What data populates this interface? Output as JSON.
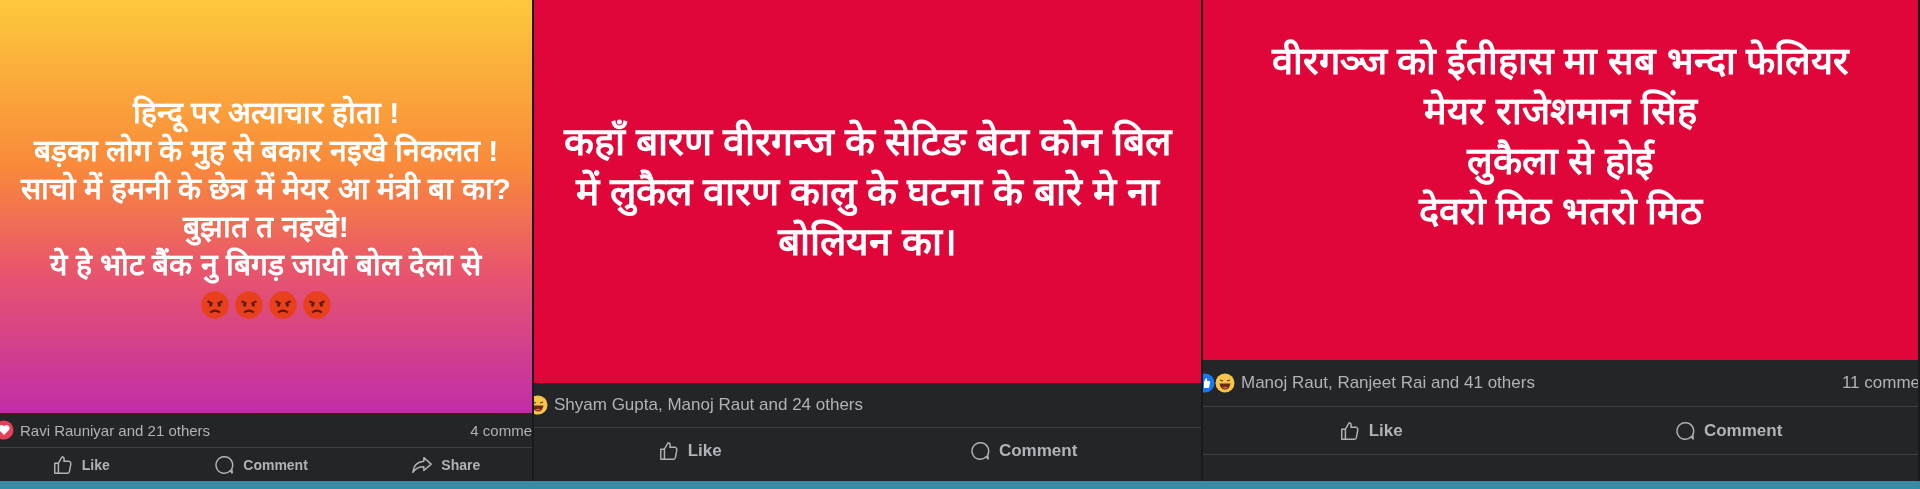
{
  "posts": [
    {
      "kind": "gradient",
      "lines": [
        "हिन्दू पर अत्याचार होता !",
        "बड़का लोग के मुह से बकार नइखे निकलत !",
        "साचो में हमनी के छेत्र में मेयर आ मंत्री बा का? बुझात त नइखे!",
        "ये हे भोट बैंक नु बिगड़ जायी बोल देला से"
      ],
      "emojis": [
        {
          "kind": "angry"
        },
        {
          "kind": "angry"
        },
        {
          "kind": "angry"
        },
        {
          "kind": "angry"
        }
      ],
      "reactions": [
        {
          "kind": "love"
        }
      ],
      "reacted_by": "Ravi Rauniyar and 21 others",
      "comments": "4 comme",
      "actions": [
        {
          "kind": "like",
          "label": "Like"
        },
        {
          "kind": "comment",
          "label": "Comment"
        },
        {
          "kind": "share",
          "label": "Share"
        }
      ]
    },
    {
      "kind": "red",
      "lines": [
        "कहाँ बारण वीरगन्ज के सेटिङ बेटा कोन बिल में लुकैल वारण कालु के घटना के बारे मे ना बोलियन का।"
      ],
      "reactions": [
        {
          "kind": "haha"
        }
      ],
      "reacted_by": "Shyam Gupta, Manoj Raut and 24 others",
      "actions": [
        {
          "kind": "like",
          "label": "Like"
        },
        {
          "kind": "comment",
          "label": "Comment"
        }
      ]
    },
    {
      "kind": "red",
      "lines": [
        "वीरगञ्ज को ईतीहास मा सब भन्दा फेलियर",
        "मेयर राजेशमान सिंह",
        "लुकैला से होई",
        "देवरो मिठ भतरो मिठ"
      ],
      "reactions": [
        {
          "kind": "like"
        },
        {
          "kind": "haha"
        }
      ],
      "reacted_by": "Manoj Raut, Ranjeet Rai and 41 others",
      "comments": "11 comme",
      "actions": [
        {
          "kind": "like",
          "label": "Like"
        },
        {
          "kind": "comment",
          "label": "Comment"
        }
      ]
    }
  ]
}
